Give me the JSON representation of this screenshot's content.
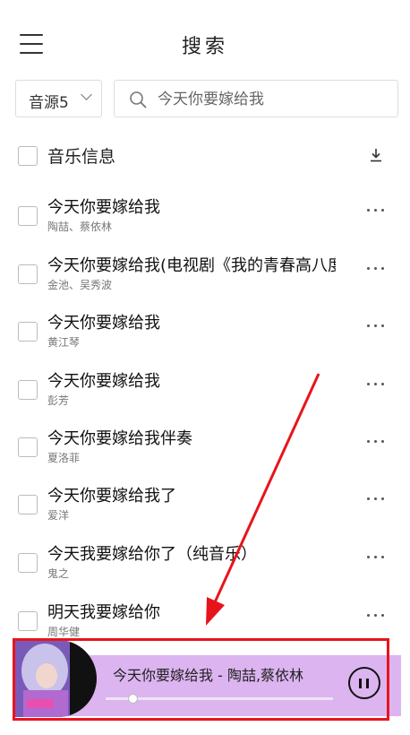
{
  "header": {
    "title": "搜索",
    "menu_icon": "hamburger-menu-icon"
  },
  "search": {
    "source_label": "音源5",
    "placeholder": "今天你要嫁给我",
    "value": ""
  },
  "list_header": {
    "label": "音乐信息",
    "download_icon": "download-icon"
  },
  "songs": [
    {
      "title": "今天你要嫁给我",
      "artist": "陶喆、蔡依林"
    },
    {
      "title": "今天你要嫁给我(电视剧《我的青春高八度》插曲)",
      "artist": "金池、吴秀波"
    },
    {
      "title": "今天你要嫁给我",
      "artist": "黄江琴"
    },
    {
      "title": "今天你要嫁给我",
      "artist": "彭芳"
    },
    {
      "title": "今天你要嫁给我伴奏",
      "artist": "夏洛菲"
    },
    {
      "title": "今天你要嫁给我了",
      "artist": "爱洋"
    },
    {
      "title": "今天我要嫁给你了（纯音乐）",
      "artist": "鬼之"
    },
    {
      "title": "明天我要嫁给你",
      "artist": "周华健"
    }
  ],
  "player": {
    "now_playing": "今天你要嫁给我 - 陶喆,蔡依林",
    "progress": 0.12,
    "pause_icon": "pause-icon",
    "accent_color": "#dcb4f0"
  },
  "annotation": {
    "color": "#e8141c"
  }
}
